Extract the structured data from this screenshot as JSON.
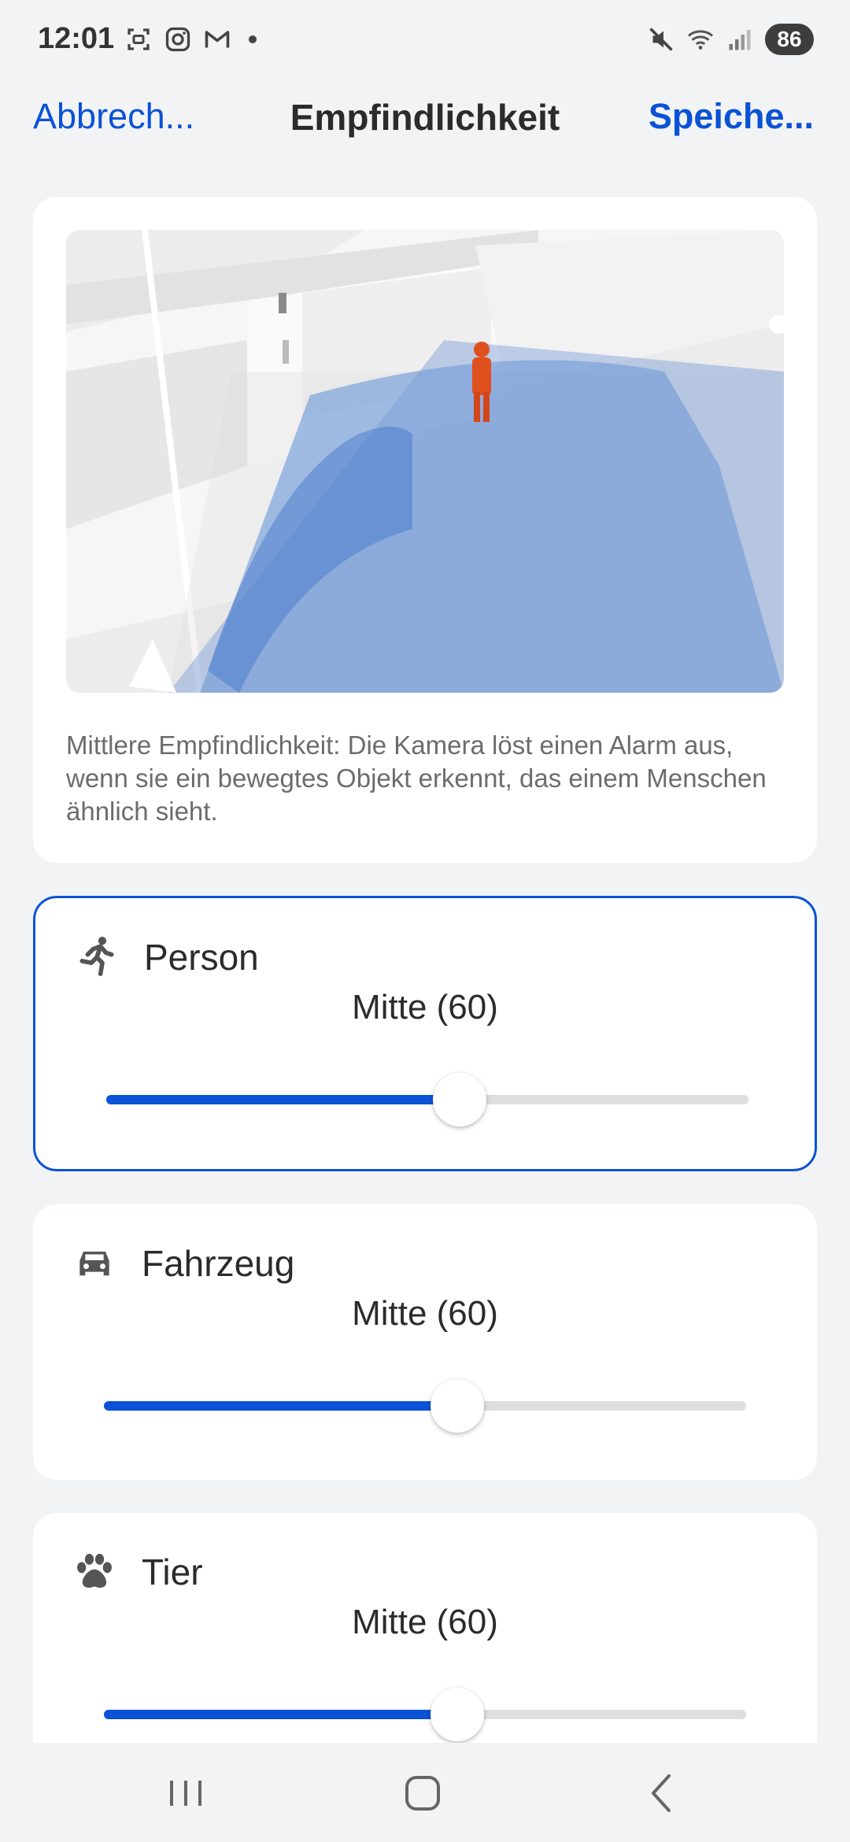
{
  "status_bar": {
    "time": "12:01",
    "left_icons": [
      "screenshot-icon",
      "instagram-icon",
      "gmail-icon"
    ],
    "right_icons": [
      "mute-icon",
      "wifi-icon",
      "signal-icon"
    ],
    "battery": "86"
  },
  "header": {
    "cancel_label": "Abbrech...",
    "title": "Empfindlichkeit",
    "save_label": "Speiche..."
  },
  "preview": {
    "description": "Mittlere Empfindlichkeit: Die Kamera löst einen Alarm aus, wenn sie ein bewegtes Objekt erkennt, das einem Menschen ähnlich sieht."
  },
  "sensitivities": [
    {
      "label": "Person",
      "value_text": "Mitte (60)",
      "level": 0.55,
      "icon": "running-person-icon",
      "selected": true
    },
    {
      "label": "Fahrzeug",
      "value_text": "Mitte (60)",
      "level": 0.55,
      "icon": "car-icon",
      "selected": false
    },
    {
      "label": "Tier",
      "value_text": "Mitte (60)",
      "level": 0.55,
      "icon": "paw-icon",
      "selected": false
    }
  ],
  "colors": {
    "accent": "#0a52d6",
    "background": "#f2f3f5",
    "card": "#ffffff",
    "track": "#dedede"
  },
  "bottom_nav": {
    "icons": [
      "recents-icon",
      "home-icon",
      "back-icon"
    ]
  }
}
